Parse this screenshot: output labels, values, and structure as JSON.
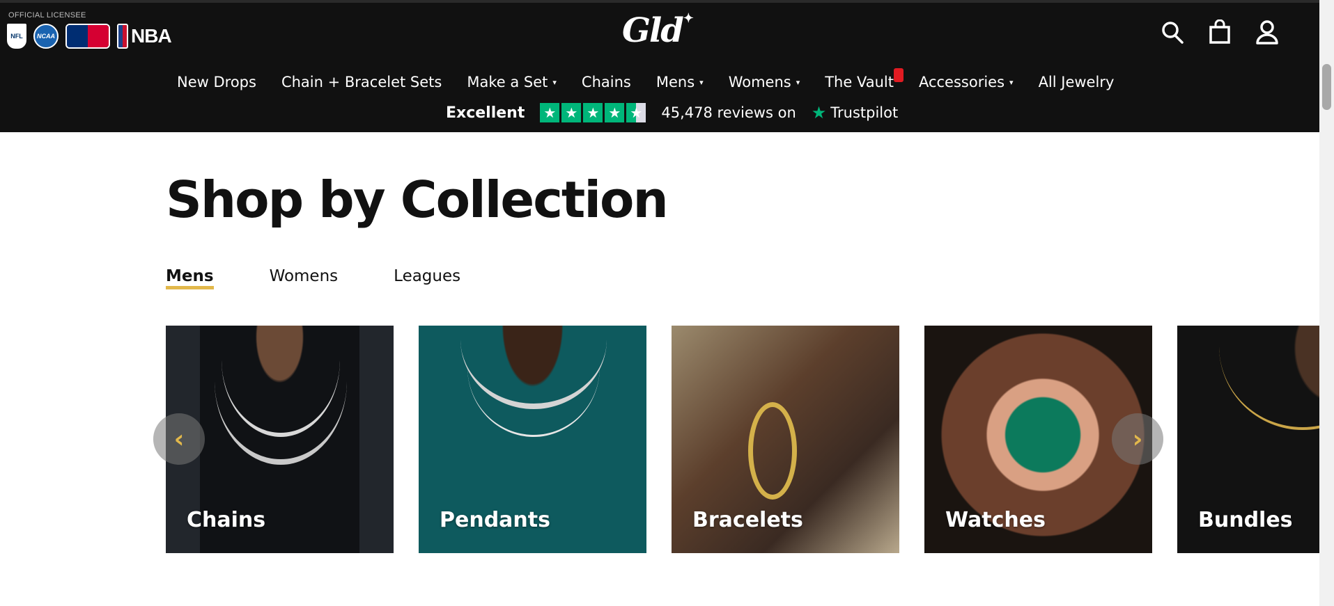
{
  "header": {
    "licensee_label": "OFFICIAL LICENSEE",
    "leagues": [
      "NFL",
      "NCAA",
      "MLB",
      "NBA"
    ],
    "brand": "Gld",
    "icons": [
      "search-icon",
      "bag-icon",
      "account-icon"
    ]
  },
  "nav": {
    "items": [
      {
        "label": "New Drops",
        "dropdown": false
      },
      {
        "label": "Chain + Bracelet Sets",
        "dropdown": false
      },
      {
        "label": "Make a Set",
        "dropdown": true
      },
      {
        "label": "Chains",
        "dropdown": false
      },
      {
        "label": "Mens",
        "dropdown": true
      },
      {
        "label": "Womens",
        "dropdown": true
      },
      {
        "label": "The Vault",
        "dropdown": false,
        "badge": true
      },
      {
        "label": "Accessories",
        "dropdown": true
      },
      {
        "label": "All Jewelry",
        "dropdown": false
      }
    ],
    "caret": "▾"
  },
  "trust": {
    "rating_word": "Excellent",
    "stars": 4.5,
    "review_text": "45,478 reviews on",
    "provider": "Trustpilot"
  },
  "collection": {
    "title": "Shop by Collection",
    "tabs": [
      "Mens",
      "Womens",
      "Leagues"
    ],
    "active_tab": "Mens",
    "cards": [
      "Chains",
      "Pendants",
      "Bracelets",
      "Watches",
      "Bundles"
    ],
    "prev_arrow": "‹",
    "next_arrow": "›"
  },
  "colors": {
    "header_bg": "#111111",
    "accent": "#e2b84b",
    "trustpilot_green": "#00b67a"
  }
}
